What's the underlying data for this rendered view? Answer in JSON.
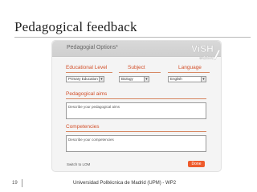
{
  "slide": {
    "title": "Pedagogical feedback",
    "page_number": "19",
    "footer": "Universidad Politécnica de Madrid (UPM) - WP2"
  },
  "panel": {
    "title": "Pedagogial Options*",
    "logo_text_line1": "ViSH",
    "logo_text_line2": "editor",
    "educational_level": {
      "label": "Educational Level",
      "selected": "Primary Education",
      "arrow": "▼"
    },
    "subject": {
      "label": "Subject",
      "selected": "Biology",
      "arrow": "▼"
    },
    "language": {
      "label": "Language",
      "selected": "English",
      "arrow": "▼"
    },
    "pedagogical_aims": {
      "label": "Pedagogical aims",
      "placeholder": "Describe your pedagogical aims"
    },
    "competencies": {
      "label": "Competencies",
      "placeholder": "Describe your competencies"
    },
    "switch_link": "Switch to LOM",
    "done_label": "Done"
  },
  "colors": {
    "accent": "#d2502a",
    "button": "#ee5b2c",
    "logo_green": "#a9c741"
  }
}
